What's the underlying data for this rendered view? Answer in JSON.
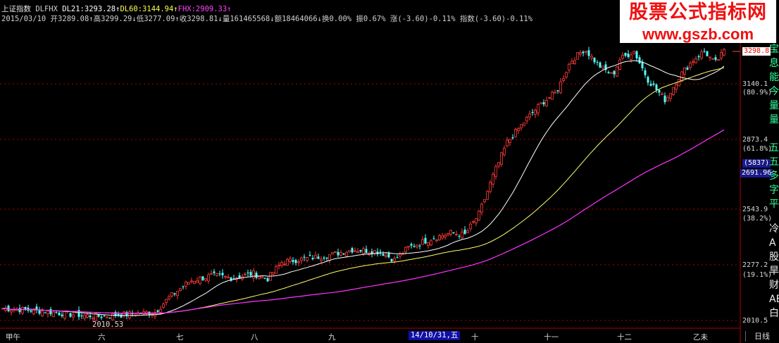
{
  "header": {
    "line1": [
      {
        "text": "上证指数 ",
        "color": "#e8e8e8"
      },
      {
        "text": "DLFHX ",
        "color": "#d0d0d0"
      },
      {
        "text": "DL21:3293.28↑",
        "color": "#ffffff"
      },
      {
        "text": "DL60:3144.94↑",
        "color": "#ffff55"
      },
      {
        "text": "FHX:2909.33↑",
        "color": "#ff44ff"
      }
    ],
    "line2": [
      {
        "text": "2015/03/10 ",
        "color": "#d0d0d0"
      },
      {
        "text": "开3289.08↑",
        "color": "#d0d0d0"
      },
      {
        "text": "高3299.29↓",
        "color": "#d0d0d0"
      },
      {
        "text": "低3277.09↑",
        "color": "#d0d0d0"
      },
      {
        "text": "收3298.81↓",
        "color": "#d0d0d0"
      },
      {
        "text": "量161465568↓",
        "color": "#d0d0d0"
      },
      {
        "text": "额18464066↓",
        "color": "#d0d0d0"
      },
      {
        "text": "换0.00% ",
        "color": "#d0d0d0"
      },
      {
        "text": "振0.67% ",
        "color": "#d0d0d0"
      },
      {
        "text": "涨(-3.60)-0.11% ",
        "color": "#d0d0d0"
      },
      {
        "text": "指数(-3.60)-0.11%",
        "color": "#d0d0d0"
      }
    ]
  },
  "watermark": {
    "line1": "股票公式指标网",
    "line2": "www.gszb.com"
  },
  "right_axis": {
    "current_price": "3298.8",
    "levels": [
      {
        "price": "3140.1",
        "pct": "(80.9%)"
      },
      {
        "price": "2873.4",
        "pct": "(61.8%)"
      },
      {
        "price": "2543.9",
        "pct": "(38.2%)"
      },
      {
        "price": "2277.2",
        "pct": "(19.1%)"
      },
      {
        "price": "2010.5",
        "pct": ""
      }
    ],
    "count_badge": "(5837)",
    "cursor_price": "2691.96"
  },
  "low_annotation": "2010.53",
  "date_tag": "14/10/31,五",
  "period_button": "日线",
  "side_text_a": "宝息能今量量",
  "side_text_b": "五五多字平",
  "side_text_c": "冷A股旱财ABA白",
  "colors": {
    "up": "#ff3a3a",
    "down": "#54ffff",
    "ma21": "#ffffff",
    "ma60": "#ffff66",
    "fhx": "#ff33ff",
    "grid": "#b00000"
  },
  "chart_data": {
    "type": "candlestick",
    "title": "上证指数",
    "x_period_labels": [
      "甲午",
      "六",
      "七",
      "八",
      "九",
      "十",
      "十一",
      "十二",
      "乙未"
    ],
    "y_range": [
      2010.5,
      3298.8
    ],
    "fib_levels": [
      3140.1,
      2873.4,
      2543.9,
      2277.2,
      2010.5
    ],
    "series": [
      {
        "name": "DL21",
        "last": 3293.28
      },
      {
        "name": "DL60",
        "last": 3144.94
      },
      {
        "name": "FHX",
        "last": 2909.33
      }
    ],
    "last_bar": {
      "date": "2015/03/10",
      "open": 3289.08,
      "high": 3299.29,
      "low": 3277.09,
      "close": 3298.81,
      "volume": 161465568,
      "amount": 18464066,
      "change": -3.6,
      "change_pct": -0.11
    }
  }
}
